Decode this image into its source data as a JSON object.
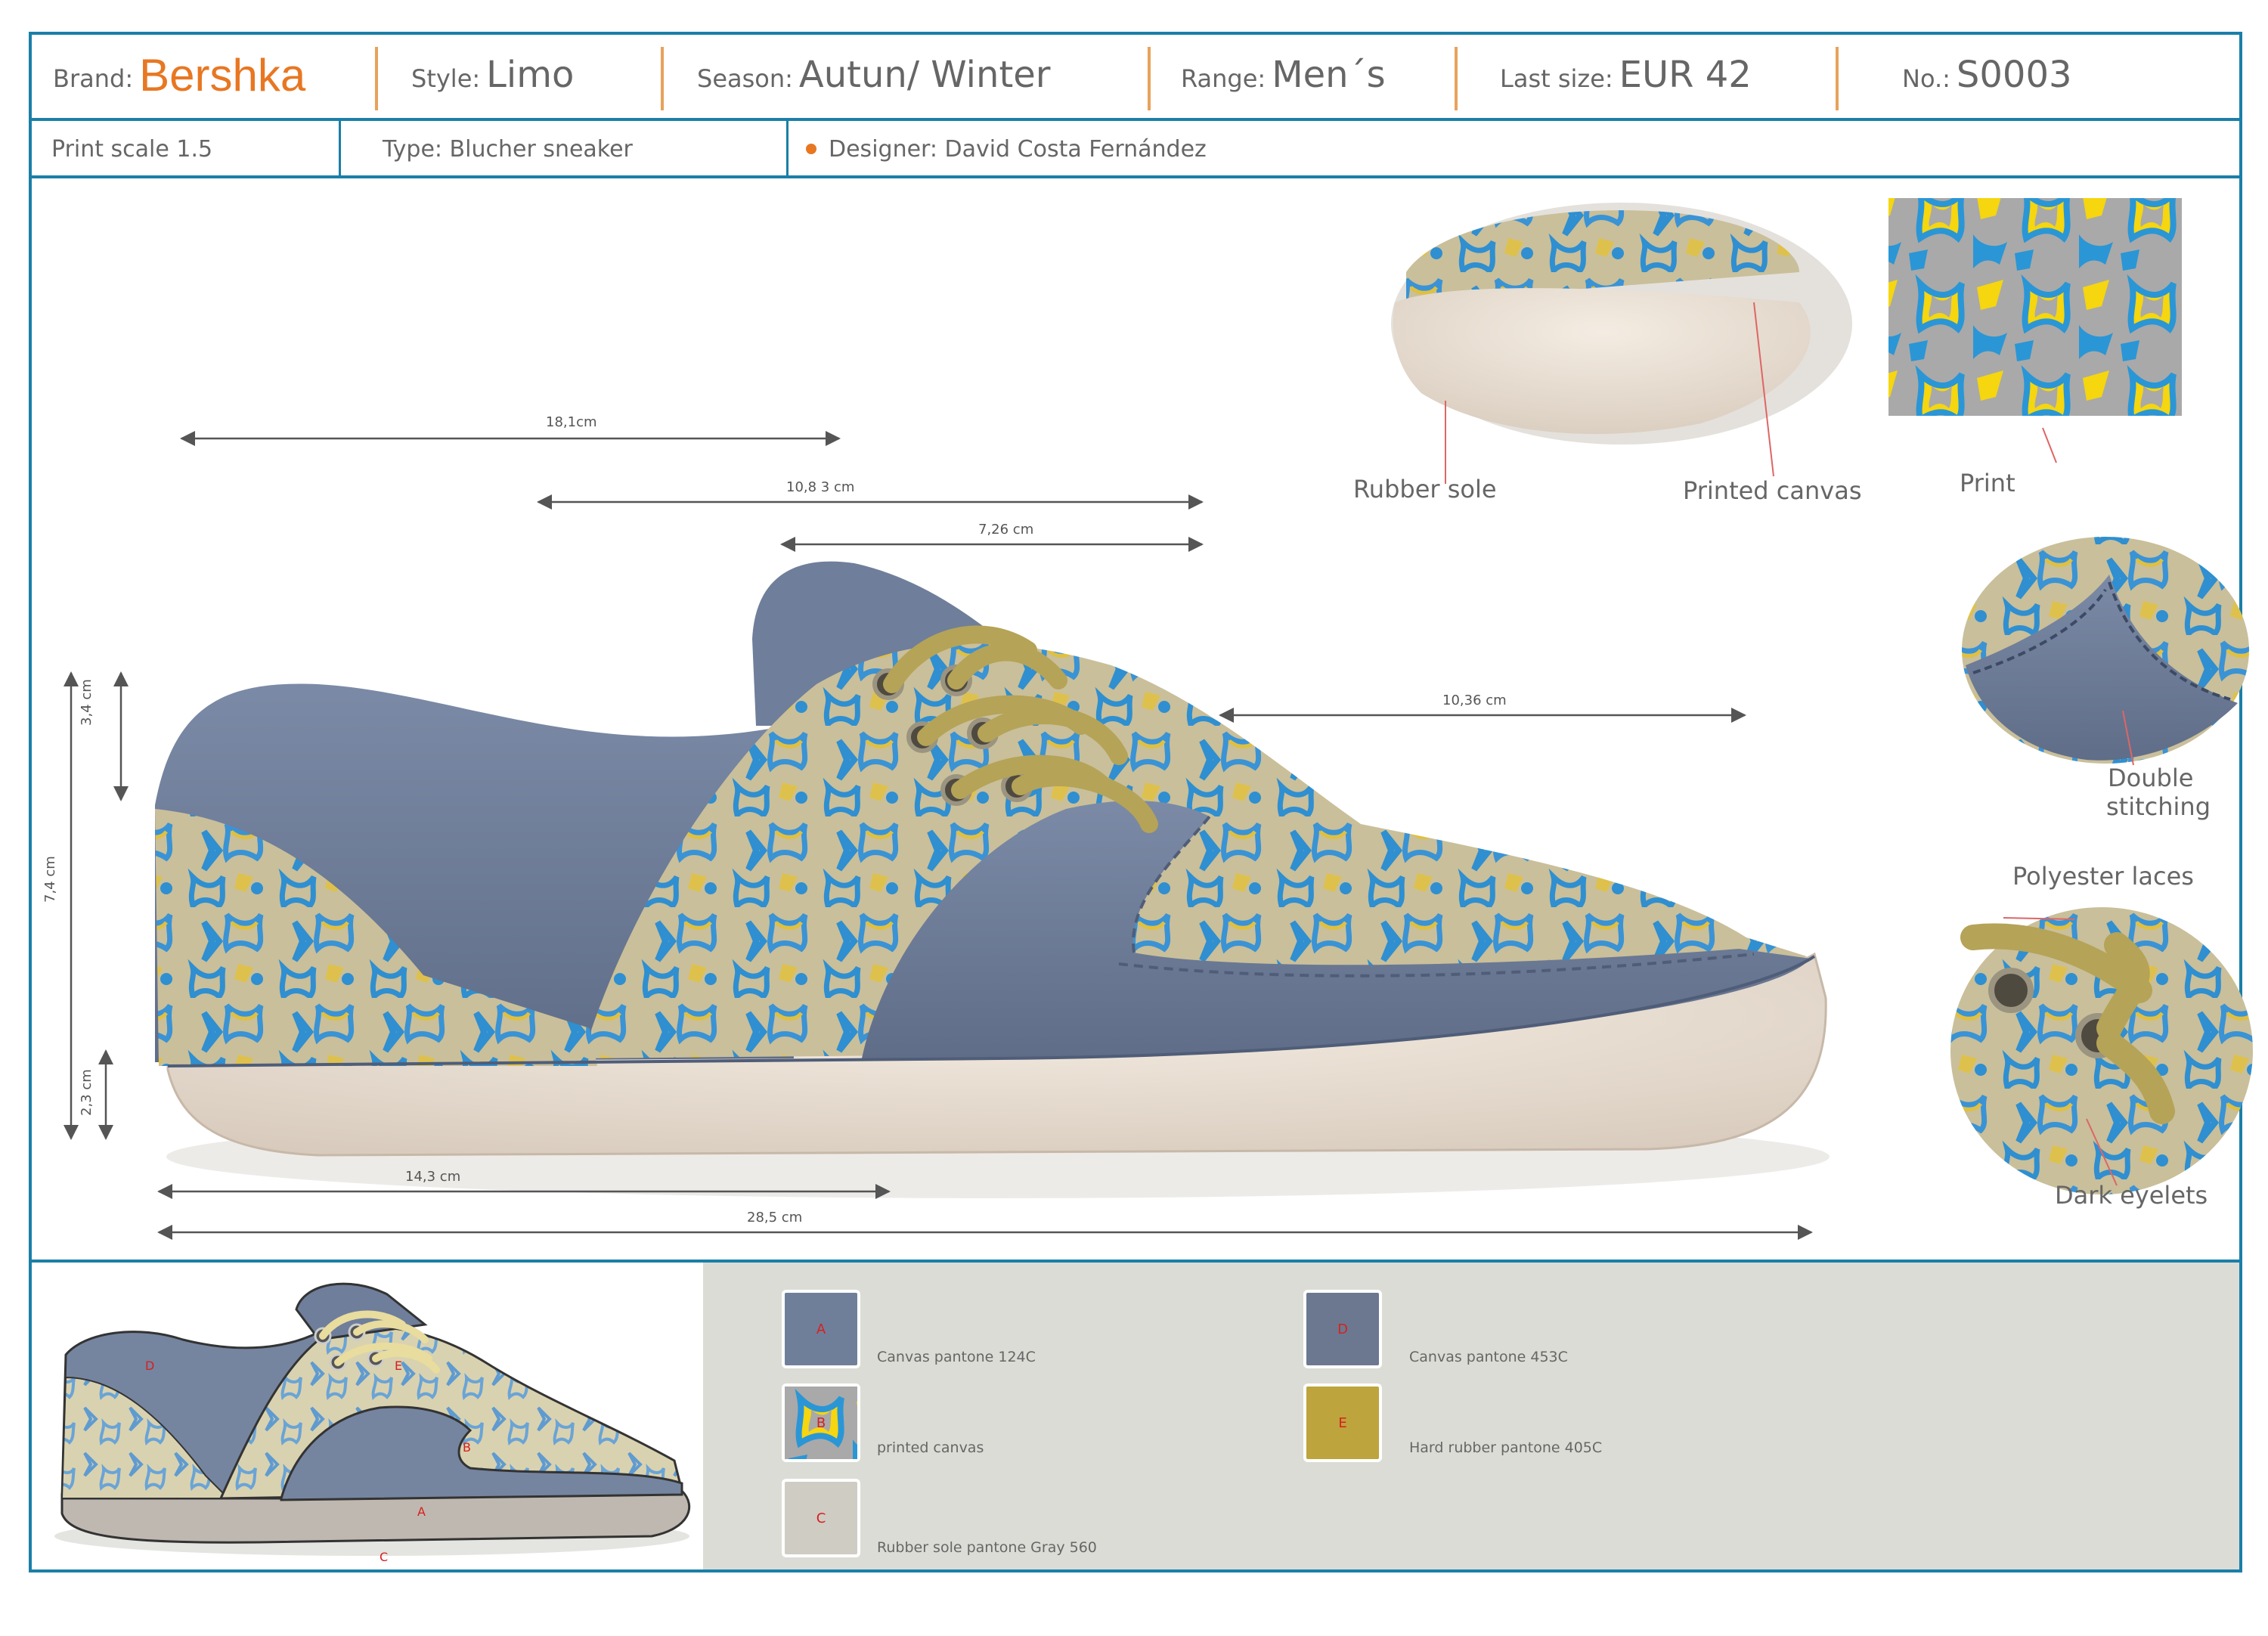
{
  "header": {
    "brand_label": "Brand:",
    "brand": "Bershka",
    "style_label": "Style:",
    "style": "Limo",
    "season_label": "Season:",
    "season": "Autun/ Winter",
    "range_label": "Range:",
    "range": "Men´s",
    "last_size_label": "Last size:",
    "last_size": "EUR 42",
    "no_label": "No.:",
    "no": "S0003"
  },
  "info": {
    "print_scale": "Print scale 1.5",
    "type": "Type: Blucher sneaker",
    "designer": "Designer: David Costa Fernández"
  },
  "dimensions": {
    "d1": "18,1cm",
    "d2": "10,8 3 cm",
    "d3": "7,26  cm",
    "d4": "10,36 cm",
    "d5": "14,3 cm",
    "d6": "28,5 cm",
    "v1": "3,4 cm",
    "v2": "7,4 cm",
    "v3": "2,3 cm"
  },
  "callouts": {
    "rubber_sole": "Rubber sole",
    "printed_canvas": "Printed canvas",
    "print": "Print",
    "double_stitching_1": "Double",
    "double_stitching_2": "stitching",
    "polyester_laces": "Polyester laces",
    "dark_eyelets": "Dark eyelets"
  },
  "sketch_letters": {
    "a": "A",
    "b": "B",
    "c": "C",
    "d": "D",
    "e": "E"
  },
  "materials": [
    {
      "letter": "A",
      "label": "Canvas pantone 124C",
      "color": "#707f99"
    },
    {
      "letter": "B",
      "label": "printed canvas",
      "color": "#f2d419"
    },
    {
      "letter": "C",
      "label": "Rubber sole pantone Gray 560",
      "color": "#cfccc4"
    },
    {
      "letter": "D",
      "label": "Canvas pantone 453C",
      "color": "#6c7890"
    },
    {
      "letter": "E",
      "label": "Hard rubber pantone 405C",
      "color": "#bda43c"
    }
  ],
  "colors": {
    "frame": "#1a7fa8",
    "brand": "#e87722",
    "separator": "#e8a25c",
    "palette_bg": "#dcdcd6"
  }
}
